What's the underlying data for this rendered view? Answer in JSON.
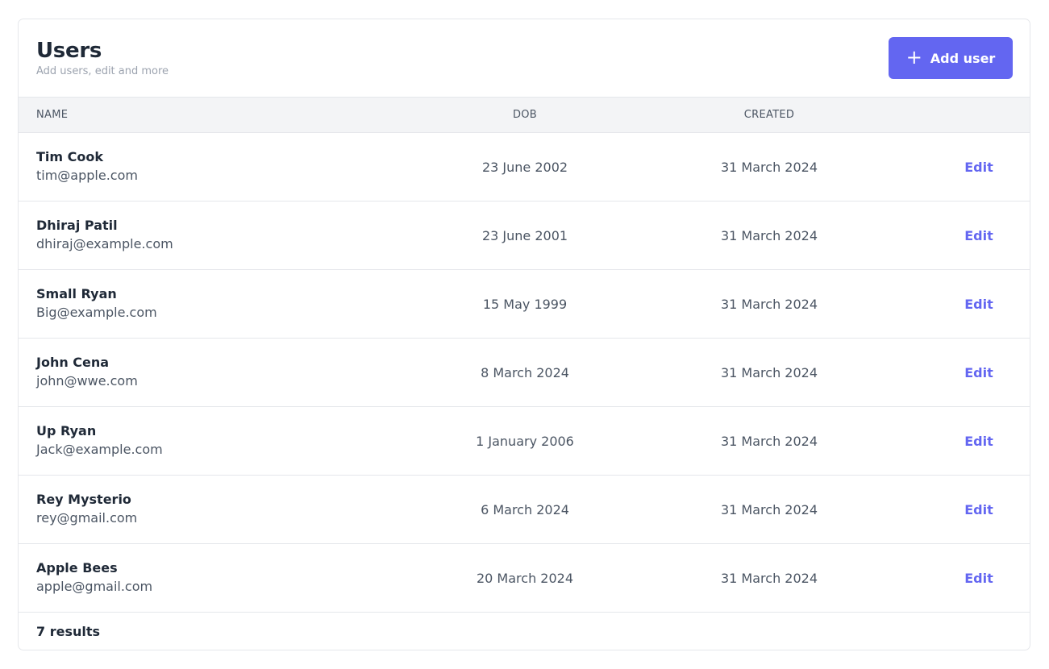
{
  "header": {
    "title": "Users",
    "subtitle": "Add users, edit and more",
    "add_button_label": "Add user",
    "add_button_icon": "plus-icon",
    "accent_color": "#6366f1"
  },
  "table": {
    "columns": [
      "NAME",
      "DOB",
      "CREATED",
      ""
    ],
    "rows": [
      {
        "name": "Tim Cook",
        "email": "tim@apple.com",
        "dob": "23 June 2002",
        "created": "31 March 2024",
        "action": "Edit"
      },
      {
        "name": "Dhiraj Patil",
        "email": "dhiraj@example.com",
        "dob": "23 June 2001",
        "created": "31 March 2024",
        "action": "Edit"
      },
      {
        "name": "Small Ryan",
        "email": "Big@example.com",
        "dob": "15 May 1999",
        "created": "31 March 2024",
        "action": "Edit"
      },
      {
        "name": "John Cena",
        "email": "john@wwe.com",
        "dob": "8 March 2024",
        "created": "31 March 2024",
        "action": "Edit"
      },
      {
        "name": "Up Ryan",
        "email": "Jack@example.com",
        "dob": "1 January 2006",
        "created": "31 March 2024",
        "action": "Edit"
      },
      {
        "name": "Rey Mysterio",
        "email": "rey@gmail.com",
        "dob": "6 March 2024",
        "created": "31 March 2024",
        "action": "Edit"
      },
      {
        "name": "Apple Bees",
        "email": "apple@gmail.com",
        "dob": "20 March 2024",
        "created": "31 March 2024",
        "action": "Edit"
      }
    ]
  },
  "footer": {
    "results_text": "7 results"
  }
}
